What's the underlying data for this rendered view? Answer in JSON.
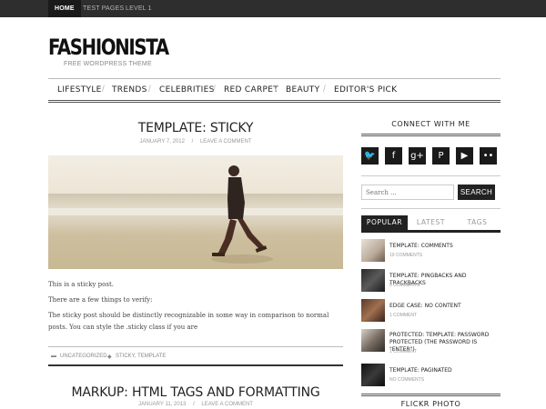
{
  "topbar": {
    "items": [
      "HOME",
      "TEST PAGES",
      "LEVEL 1"
    ]
  },
  "site": {
    "title": "FASHIONISTA",
    "tagline": "FREE WORDPRESS THEME"
  },
  "nav": {
    "items": [
      "LIFESTYLE",
      "TRENDS",
      "CELEBRITIES",
      "RED CARPET",
      "BEAUTY",
      "EDITOR'S PICK"
    ]
  },
  "post1": {
    "title": "TEMPLATE: STICKY",
    "date": "JANUARY 7, 2012",
    "comment_link": "LEAVE A COMMENT",
    "paragraphs": [
      "This is a sticky post.",
      "There are a few things to verify:",
      "The sticky post should be distinctly recognizable in some way in comparison to normal posts. You can style the .sticky class if you are"
    ],
    "category": "UNCATEGORIZED",
    "tags": "STICKY, TEMPLATE"
  },
  "post2": {
    "title": "MARKUP: HTML TAGS AND FORMATTING",
    "date": "JANUARY 11, 2013",
    "comment_link": "LEAVE A COMMENT"
  },
  "sidebar": {
    "connect_title": "CONNECT WITH ME",
    "social_icons": [
      "twitter-icon",
      "facebook-icon",
      "google-plus-icon",
      "pinterest-icon",
      "youtube-icon",
      "flickr-icon"
    ],
    "social_glyphs": [
      "🐦",
      "f",
      "g+",
      "P",
      "▶",
      "••"
    ],
    "search_placeholder": "Search ...",
    "search_button": "SEARCH",
    "tabs": [
      "POPULAR",
      "LATEST",
      "TAGS"
    ],
    "popular": [
      {
        "title": "TEMPLATE: COMMENTS",
        "count": "19 COMMENTS"
      },
      {
        "title": "TEMPLATE: PINGBACKS AND TRACKBACKS",
        "count": "5 COMMENTS"
      },
      {
        "title": "EDGE CASE: NO CONTENT",
        "count": "1 COMMENT"
      },
      {
        "title": "PROTECTED: TEMPLATE: PASSWORD PROTECTED (THE PASSWORD IS \"ENTER\")",
        "count": "1 COMMENT"
      },
      {
        "title": "TEMPLATE: PAGINATED",
        "count": "NO COMMENTS"
      }
    ],
    "flickr_title": "FLICKR PHOTO"
  }
}
